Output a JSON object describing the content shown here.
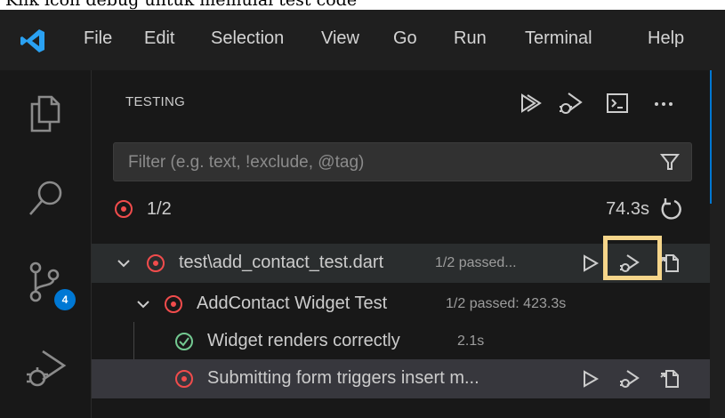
{
  "caption": {
    "text": "Klik icon debug untuk memulai test code"
  },
  "menubar": {
    "items": [
      "File",
      "Edit",
      "Selection",
      "View",
      "Go",
      "Run",
      "Terminal",
      "Help"
    ]
  },
  "activity_bar": {
    "icons": [
      "explorer-icon",
      "search-icon",
      "source-control-icon",
      "run-debug-icon"
    ],
    "source_control_badge": "4"
  },
  "testing": {
    "title": "TESTING",
    "toolbar": [
      "run-all-tests-icon",
      "debug-all-tests-icon",
      "show-output-icon",
      "more-actions-icon"
    ],
    "filter": {
      "placeholder": "Filter (e.g. text, !exclude, @tag)",
      "value": ""
    },
    "summary": {
      "result": "1/2",
      "duration": "74.3s"
    },
    "tree": [
      {
        "label": "test\\add_contact_test.dart",
        "detail": "1/2 passed...",
        "status": "failed",
        "expanded": true
      },
      {
        "label": "AddContact Widget Test",
        "detail": "1/2 passed: 423.3s",
        "status": "failed",
        "expanded": true
      },
      {
        "label": "Widget renders correctly",
        "detail": "2.1s",
        "status": "passed"
      },
      {
        "label": "Submitting form triggers insert m...",
        "detail": "",
        "status": "failed"
      }
    ]
  },
  "colors": {
    "accent": "#0078d4",
    "failed": "#f14c4c",
    "passed": "#73c991",
    "highlight": "#f5d58a"
  }
}
